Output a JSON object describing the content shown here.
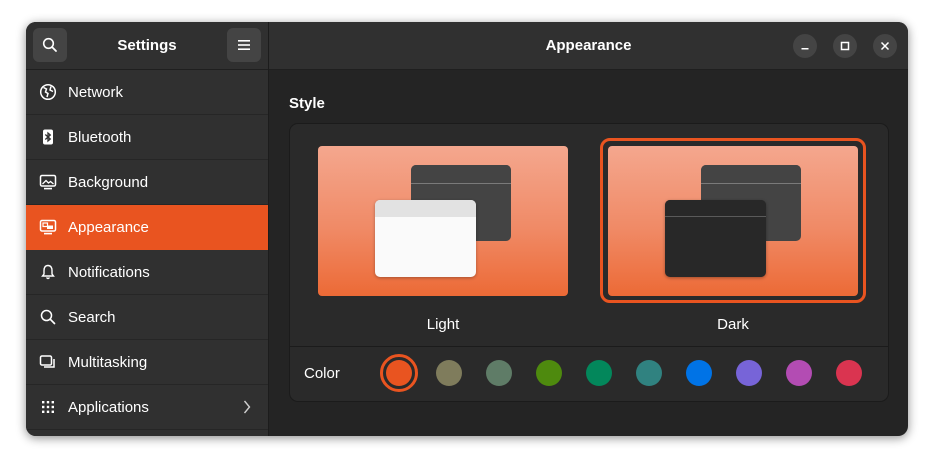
{
  "sidebar": {
    "title": "Settings",
    "items": [
      {
        "label": "Network",
        "icon": "network-icon"
      },
      {
        "label": "Bluetooth",
        "icon": "bluetooth-icon"
      },
      {
        "label": "Background",
        "icon": "background-icon"
      },
      {
        "label": "Appearance",
        "icon": "appearance-icon",
        "active": true
      },
      {
        "label": "Notifications",
        "icon": "bell-icon"
      },
      {
        "label": "Search",
        "icon": "search-icon"
      },
      {
        "label": "Multitasking",
        "icon": "multitasking-icon"
      },
      {
        "label": "Applications",
        "icon": "grid-icon",
        "has_submenu": true
      }
    ]
  },
  "header": {
    "title": "Appearance"
  },
  "style": {
    "title": "Style",
    "options": [
      {
        "label": "Light",
        "selected": false
      },
      {
        "label": "Dark",
        "selected": true
      }
    ]
  },
  "color": {
    "label": "Color",
    "accent": "#e95420",
    "swatches": [
      "#e95420",
      "#7f7c5c",
      "#5f7c67",
      "#4e8a0e",
      "#03875b",
      "#308280",
      "#0073e6",
      "#7764d8",
      "#b34cb3",
      "#da3450"
    ],
    "selected_index": 0
  }
}
